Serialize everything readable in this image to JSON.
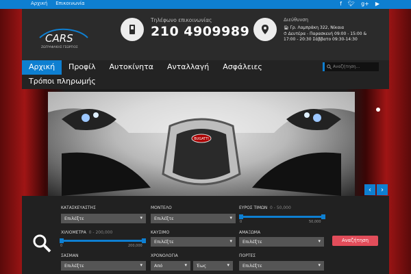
{
  "topbar": {
    "links": [
      "Αρχική",
      "Επικοινωνία"
    ]
  },
  "header": {
    "logo_text": "CARS",
    "logo_sub": "ΖΩΓΡΑΦΑΚΗΣ ΓΕΩΡΓΙΟΣ",
    "phone_label": "Τηλέφωνο επικοινωνίας",
    "phone": "210 4909989",
    "address_title": "Διεύθυνση",
    "address": "Γρ. Λαμπράκη 322, Νίκαια",
    "hours_1": "Δευτέρα - Παρασκευή 09:00 - 15:00 &",
    "hours_2": "17:00 - 20:30 Σάββατο 09:30-14:30"
  },
  "nav": {
    "items": [
      "Αρχική",
      "Προφίλ",
      "Αυτοκίνητα",
      "Ανταλλαγή",
      "Ασφάλειες"
    ],
    "second": "Τρόποι πληρωμής",
    "search_placeholder": "Αναζήτηση..."
  },
  "hero": {
    "badge": "BUGATTI"
  },
  "form": {
    "maker_label": "ΚΑΤΑΣΚΕΥΑΣΤΗΣ",
    "model_label": "ΜΟΝΤΕΛΟ",
    "price_label": "ΕΥΡΟΣ ΤΙΜΩΝ",
    "price_range": "0 - 50,000",
    "price_min": "0",
    "price_max": "50,000",
    "km_label": "ΧΙΛΙΟΜΕΤΡΑ",
    "km_range": "0 - 200,000",
    "km_min": "0",
    "km_max": "200,000",
    "fuel_label": "ΚΑΥΣΙΜΟ",
    "body_label": "ΑΜΑΞΩΜΑ",
    "chassis_label": "ΣΑΣΜΑΝ",
    "year_label": "ΧΡΟΝΟΛΟΓΙΑ",
    "doors_label": "ΠΟΡΤΕΣ",
    "choose": "Επιλέξτε",
    "from": "Από",
    "to": "Έως",
    "search_button": "Αναζήτηση"
  }
}
